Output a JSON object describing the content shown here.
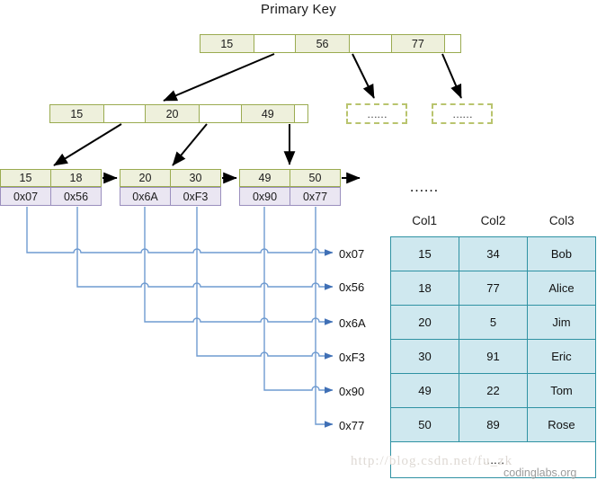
{
  "title": "Primary Key",
  "root_node": {
    "name": "root-index-node",
    "cells": [
      {
        "text": "15",
        "blank": false
      },
      {
        "text": "",
        "blank": true
      },
      {
        "text": "56",
        "blank": false
      },
      {
        "text": "",
        "blank": true
      },
      {
        "text": "77",
        "blank": false
      },
      {
        "text": "",
        "blank": true
      }
    ]
  },
  "level2_node": {
    "name": "level2-index-node",
    "cells": [
      {
        "text": "15",
        "blank": false
      },
      {
        "text": "",
        "blank": true
      },
      {
        "text": "20",
        "blank": false
      },
      {
        "text": "",
        "blank": true
      },
      {
        "text": "49",
        "blank": false
      },
      {
        "text": "",
        "blank": true
      }
    ]
  },
  "dashed_nodes": [
    {
      "text": "……"
    },
    {
      "text": "……"
    }
  ],
  "leaf_nodes": [
    {
      "keys": [
        "15",
        "18"
      ],
      "pointers": [
        "0x07",
        "0x56"
      ]
    },
    {
      "keys": [
        "20",
        "30"
      ],
      "pointers": [
        "0x6A",
        "0xF3"
      ]
    },
    {
      "keys": [
        "49",
        "50"
      ],
      "pointers": [
        "0x90",
        "0x77"
      ]
    }
  ],
  "leaf_ellipsis": "……",
  "address_labels": [
    "0x07",
    "0x56",
    "0x6A",
    "0xF3",
    "0x90",
    "0x77"
  ],
  "record_table": {
    "headers": [
      "Col1",
      "Col2",
      "Col3"
    ],
    "rows": [
      [
        "15",
        "34",
        "Bob"
      ],
      [
        "18",
        "77",
        "Alice"
      ],
      [
        "20",
        "5",
        "Jim"
      ],
      [
        "30",
        "91",
        "Eric"
      ],
      [
        "49",
        "22",
        "Tom"
      ],
      [
        "50",
        "89",
        "Rose"
      ]
    ],
    "last_row": "……"
  },
  "watermarks": {
    "csdn": "http://blog.csdn.net/fu_zk",
    "codinglabs": "codinglabs.org"
  },
  "colors": {
    "index_fill": "#eef0dc",
    "index_border": "#9aab50",
    "pointer_fill": "#eae6f2",
    "pointer_border": "#9b8fbe",
    "table_fill": "#cfe8ef",
    "table_border": "#2f92a3",
    "route_line": "#6f9bd1",
    "arrow_black": "#000000"
  }
}
